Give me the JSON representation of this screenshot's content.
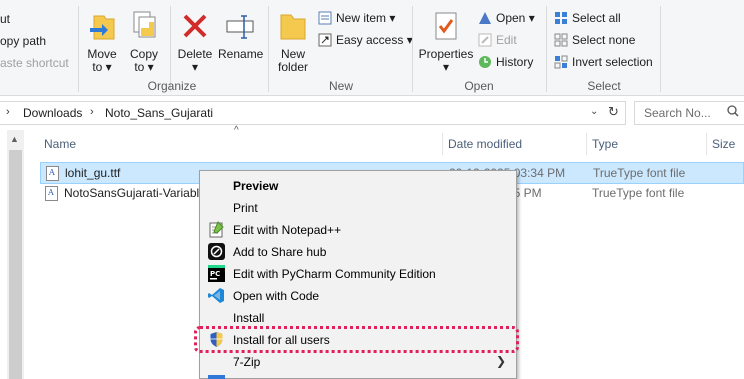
{
  "ribbon": {
    "clipboard_items": [
      "ut",
      "opy path",
      "aste shortcut"
    ],
    "organize": {
      "move_label": "Move",
      "move_sub": "to",
      "copy_label": "Copy",
      "copy_sub": "to",
      "delete_label": "Delete",
      "rename_label": "Rename",
      "group_label": "Organize"
    },
    "new": {
      "folder_line1": "New",
      "folder_line2": "folder",
      "new_item": "New item",
      "easy_access": "Easy access",
      "group_label": "New"
    },
    "open": {
      "properties": "Properties",
      "open": "Open",
      "edit": "Edit",
      "history": "History",
      "group_label": "Open"
    },
    "select": {
      "select_all": "Select all",
      "select_none": "Select none",
      "invert": "Invert selection",
      "group_label": "Select"
    }
  },
  "address": {
    "crumbs": [
      "Downloads",
      "Noto_Sans_Gujarati"
    ],
    "search_placeholder": "Search No..."
  },
  "columns": {
    "name": "Name",
    "date": "Date modified",
    "type": "Type",
    "size": "Size"
  },
  "files": [
    {
      "name": "lohit_gu.ttf",
      "date": "20-12-2025 03:34 PM",
      "type": "TrueType font file",
      "selected": true
    },
    {
      "name": "NotoSansGujarati-Variable",
      "date": "35 PM",
      "type": "TrueType font file",
      "selected": false
    }
  ],
  "context_menu": {
    "items": [
      {
        "label": "Preview",
        "icon": "none",
        "bold": true
      },
      {
        "label": "Print",
        "icon": "none"
      },
      {
        "label": "Edit with Notepad++",
        "icon": "notepad-plus-icon"
      },
      {
        "label": "Add to Share hub",
        "icon": "share-hub-icon"
      },
      {
        "label": "Edit with PyCharm Community Edition",
        "icon": "pycharm-icon"
      },
      {
        "label": "Open with Code",
        "icon": "vscode-icon"
      },
      {
        "label": "Install",
        "icon": "none"
      },
      {
        "label": "Install for all users",
        "icon": "uac-shield-icon"
      },
      {
        "label": "7-Zip",
        "icon": "none",
        "submenu": true
      }
    ]
  },
  "colors": {
    "selection_bg": "#cce8ff",
    "highlight_outline": "#e0205a"
  }
}
